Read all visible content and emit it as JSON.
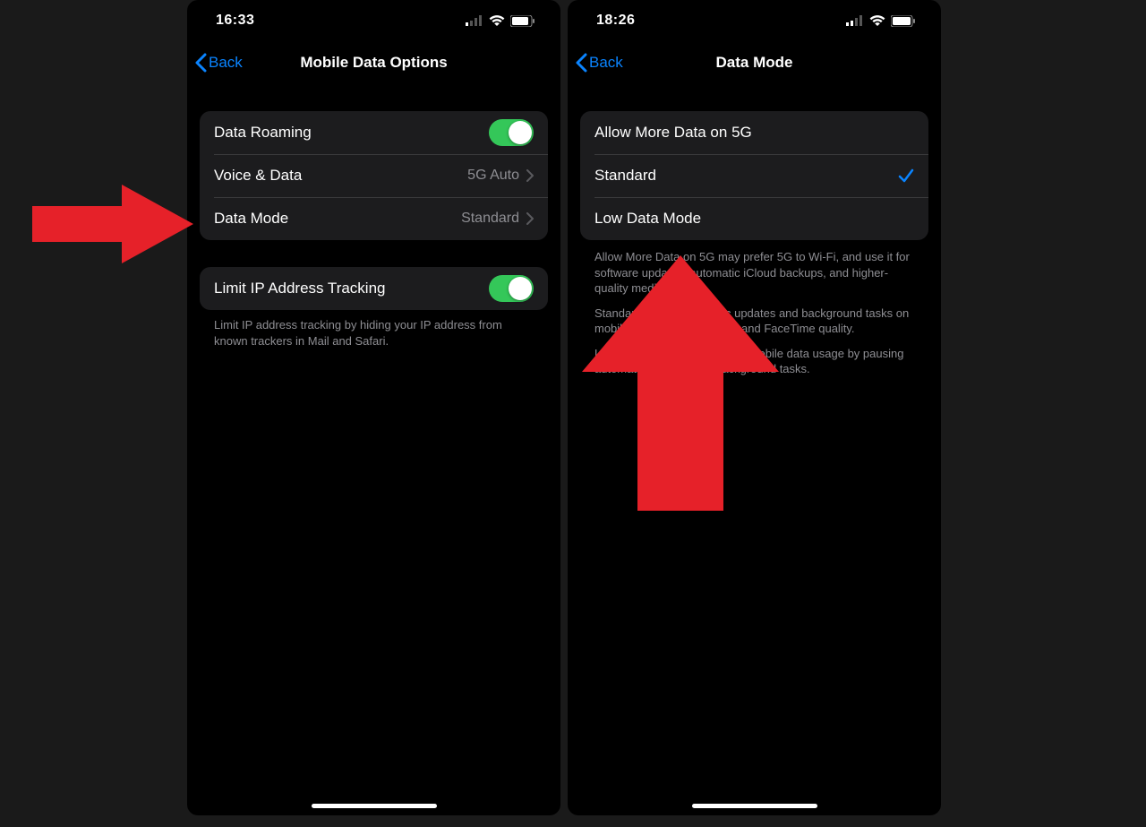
{
  "left": {
    "status_time": "16:33",
    "back_label": "Back",
    "title": "Mobile Data Options",
    "rows1": [
      {
        "label": "Data Roaming",
        "type": "toggle"
      },
      {
        "label": "Voice & Data",
        "type": "disclosure",
        "value": "5G Auto"
      },
      {
        "label": "Data Mode",
        "type": "disclosure",
        "value": "Standard"
      }
    ],
    "rows2": [
      {
        "label": "Limit IP Address Tracking",
        "type": "toggle"
      }
    ],
    "footer1": "Limit IP address tracking by hiding your IP address from known trackers in Mail and Safari."
  },
  "right": {
    "status_time": "18:26",
    "back_label": "Back",
    "title": "Data Mode",
    "rows1": [
      {
        "label": "Allow More Data on 5G",
        "type": "option"
      },
      {
        "label": "Standard",
        "type": "option",
        "selected": true
      },
      {
        "label": "Low Data Mode",
        "type": "option"
      }
    ],
    "footer1": "Allow More Data on 5G may prefer 5G to Wi-Fi, and use it for software updates, automatic iCloud backups, and higher-quality media.",
    "footer2": "Standard allows automatic updates and background tasks on mobile data, but limits video and FaceTime quality.",
    "footer3": "Low Data Mode helps reduce mobile data usage by pausing automatic updates and background tasks."
  },
  "colors": {
    "accent": "#0a84ff",
    "toggle_on": "#34c759",
    "arrow": "#e62129"
  }
}
